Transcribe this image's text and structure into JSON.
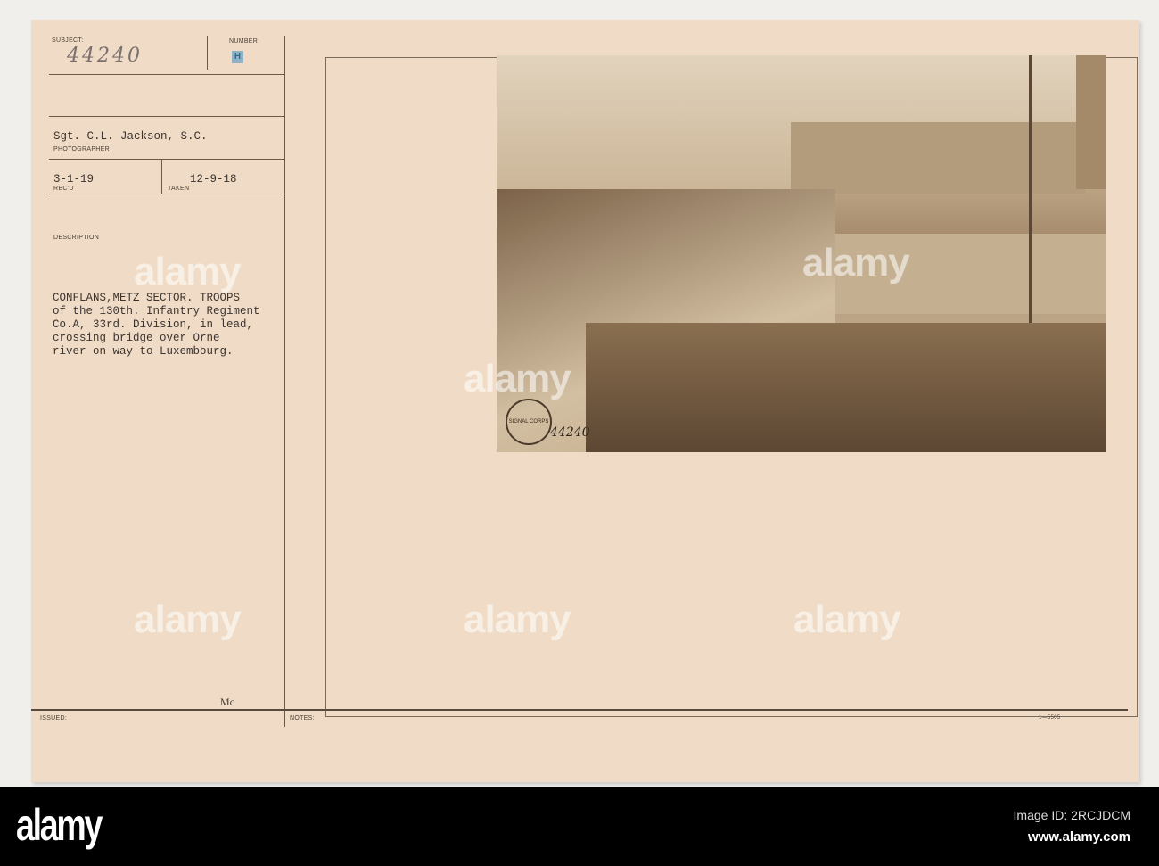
{
  "card": {
    "subject_label": "SUBJECT:",
    "subject_value": "44240",
    "number_label": "NUMBER",
    "number_stamp": "H",
    "photographer": "Sgt. C.L. Jackson, S.C.",
    "photographer_label": "PHOTOGRAPHER",
    "received": "3-1-19",
    "received_label": "REC'D",
    "taken": "12-9-18",
    "taken_label": "TAKEN",
    "description_label": "DESCRIPTION",
    "description_lines": [
      "CONFLANS,METZ SECTOR. TROOPS",
      "of the 130th. Infantry Regiment",
      "Co.A, 33rd. Division, in lead,",
      "crossing bridge over Orne",
      "river on way to Luxembourg."
    ],
    "initials": "Mc",
    "issued_label": "ISSUED:",
    "notes_label": "NOTES:",
    "form_number": "1—5505"
  },
  "photo": {
    "stamp_text": "SIGNAL CORPS U.S.A.",
    "number": "44240"
  },
  "watermark": "alamy",
  "footer": {
    "logo": "alamy",
    "image_id": "Image ID: 2RCJDCM",
    "url": "www.alamy.com"
  }
}
